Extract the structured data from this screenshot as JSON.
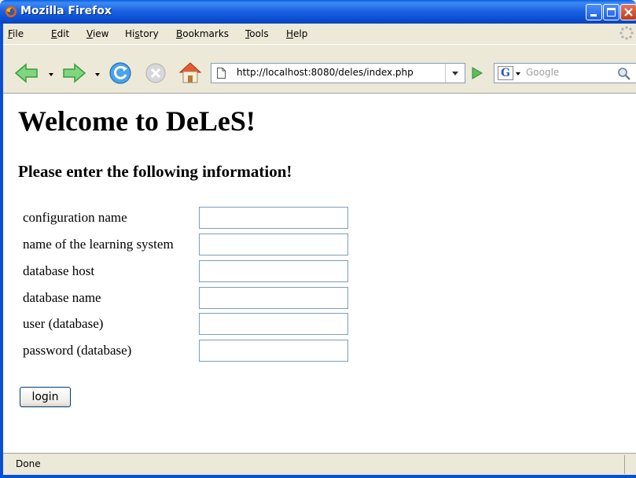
{
  "window": {
    "title": "Mozilla Firefox"
  },
  "menu": {
    "items": [
      {
        "label": "File",
        "accel": "F",
        "rest": "ile"
      },
      {
        "label": "Edit",
        "accel": "E",
        "rest": "dit"
      },
      {
        "label": "View",
        "accel": "V",
        "rest": "iew"
      },
      {
        "label": "History",
        "pre": "Hi",
        "accel": "s",
        "rest": "tory"
      },
      {
        "label": "Bookmarks",
        "accel": "B",
        "rest": "ookmarks"
      },
      {
        "label": "Tools",
        "accel": "T",
        "rest": "ools"
      },
      {
        "label": "Help",
        "accel": "H",
        "rest": "elp"
      }
    ]
  },
  "toolbar": {
    "url": "http://localhost:8080/deles/index.php",
    "search_placeholder": "Google",
    "icons": [
      "back-arrow-icon",
      "forward-arrow-icon",
      "reload-icon",
      "stop-icon",
      "home-icon",
      "go-arrow-icon",
      "google-icon",
      "magnifier-icon"
    ]
  },
  "page": {
    "heading": "Welcome to DeLeS!",
    "subheading": "Please enter the following information!",
    "fields": [
      {
        "label": "configuration name",
        "value": ""
      },
      {
        "label": "name of the learning system",
        "value": ""
      },
      {
        "label": "database host",
        "value": ""
      },
      {
        "label": "database name",
        "value": ""
      },
      {
        "label": "user (database)",
        "value": ""
      },
      {
        "label": "password (database)",
        "value": ""
      }
    ],
    "submit_label": "login"
  },
  "status": {
    "text": "Done"
  },
  "colors": {
    "titlebar": "#0a4fd3",
    "chrome": "#ece9d8",
    "input_border": "#7f9db9"
  }
}
